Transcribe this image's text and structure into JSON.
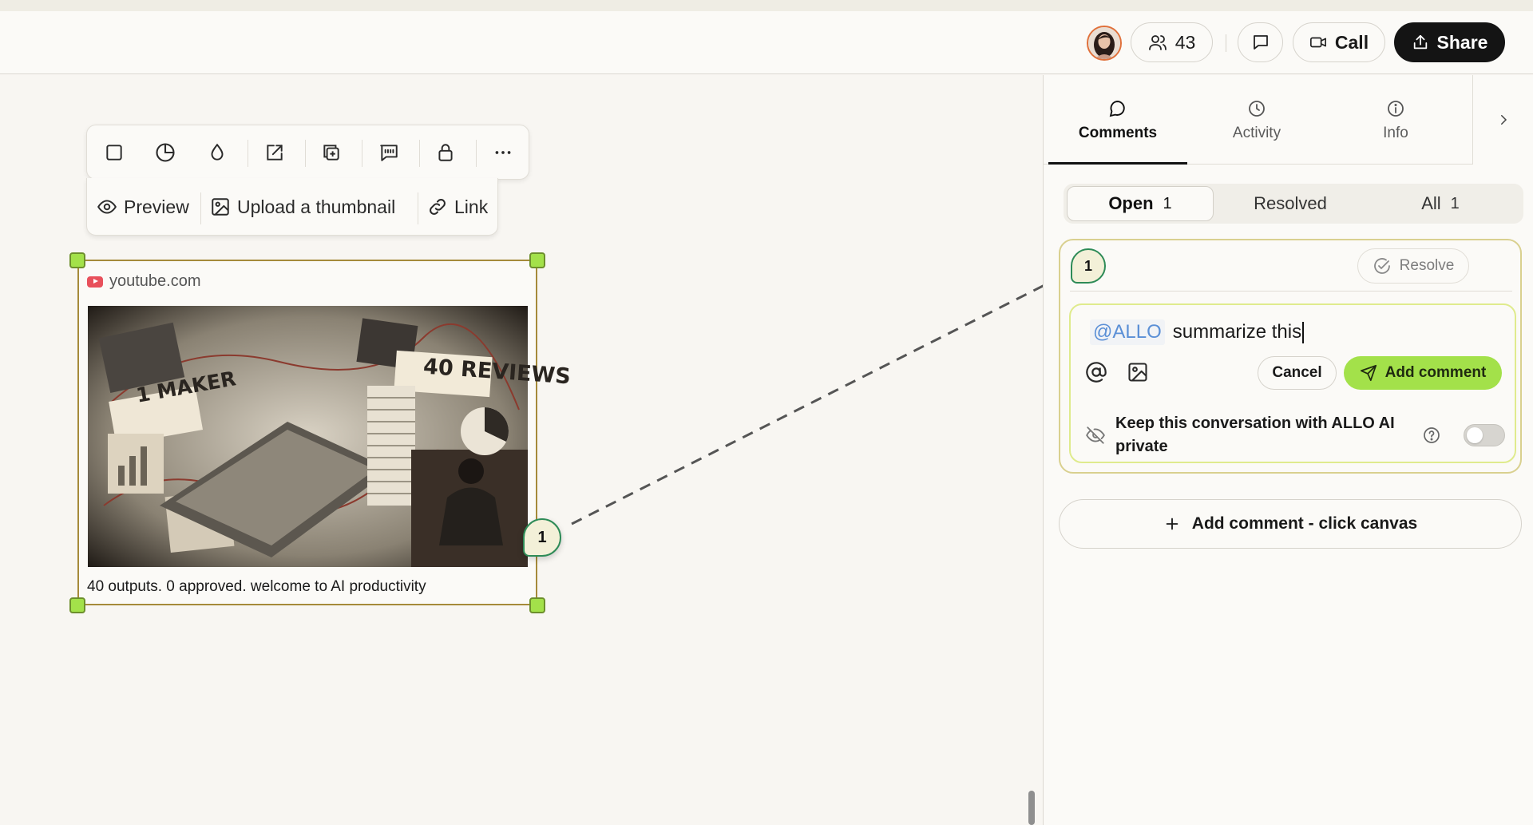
{
  "header": {
    "participants_count": "43",
    "call_label": "Call",
    "share_label": "Share"
  },
  "toolbar": {
    "icons": [
      "frame-icon",
      "clock-icon",
      "color-drop-icon",
      "open-external-icon",
      "duplicate-icon",
      "comment-quote-icon",
      "lock-icon",
      "more-icon"
    ],
    "preview_label": "Preview",
    "upload_label": "Upload a thumbnail",
    "link_label": "Link"
  },
  "card": {
    "source": "youtube.com",
    "thumbnail_text_left": "1 MAKER",
    "thumbnail_text_right": "40 REVIEWS",
    "caption": "40 outputs. 0 approved. welcome to AI productivity",
    "comment_pin": "1"
  },
  "panel": {
    "tabs": [
      {
        "label": "Comments",
        "icon": "chat-bubble-icon",
        "active": true
      },
      {
        "label": "Activity",
        "icon": "clock-icon",
        "active": false
      },
      {
        "label": "Info",
        "icon": "info-icon",
        "active": false
      }
    ],
    "filters": {
      "open_label": "Open",
      "open_count": "1",
      "resolved_label": "Resolved",
      "all_label": "All",
      "all_count": "1"
    },
    "thread": {
      "pin_number": "1",
      "resolve_label": "Resolve",
      "mention": "@ALLO",
      "draft_text": "summarize this",
      "cancel_label": "Cancel",
      "add_comment_label": "Add comment",
      "private_label": "Keep this conversation with ALLO AI private",
      "private_enabled": false
    },
    "add_canvas_label": "Add comment - click canvas"
  },
  "colors": {
    "accent_green": "#a3e14a",
    "pin_border": "#2e8b57",
    "selection_border": "#a58a3a",
    "mention_blue": "#5a8fd6"
  }
}
